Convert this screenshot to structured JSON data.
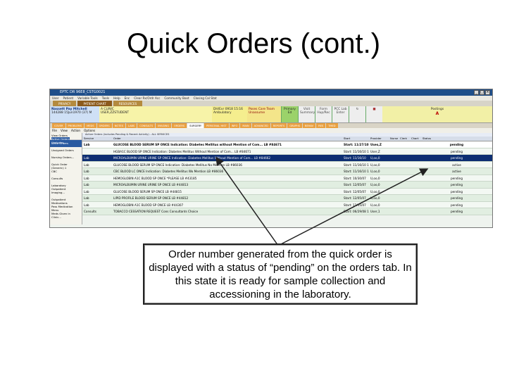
{
  "slide": {
    "title": "Quick Orders (cont.)",
    "callout": "Order number generated from the quick order is displayed with a status of “pending” on the orders tab. In this state it is ready for sample collection and accessioning in the laboratory."
  },
  "app": {
    "window_title": "EPTC DR 96E8_CSTG0021",
    "menu": [
      "User",
      "Patient",
      "Variable Tools",
      "Tools",
      "Help",
      "Enc",
      "Clear Rx/Ordr Acc",
      "Community Boot",
      "Closing Cal Stat"
    ],
    "app_tabs": [
      {
        "label": "PRIVACY",
        "active": false
      },
      {
        "label": "PATIENT CHART",
        "active": true
      },
      {
        "label": "RESOURCES",
        "active": false
      }
    ],
    "patient": {
      "name": "Nassett Pay Mitchell",
      "id": "144288",
      "dob": "15Jun1970 (37)",
      "sex": "M",
      "clinic": "A CLINIC",
      "user": "USER,ZZSTUDENT",
      "dates": "DH/Evr 0918 15:16",
      "visit": "Ambulatory",
      "problem": "Poses Care Team Unassume",
      "btn1a": "Primary",
      "btn1b": "Ed",
      "btn2a": "Visit",
      "btn2b": "Summary",
      "btn3a": "Form",
      "btn3b": "Hup/Rec",
      "btn4a": "PCC Lab",
      "btn4b": "Enter",
      "postings": "Postings",
      "flag": "A"
    },
    "function_tabs": [
      "COVER",
      "PROBLEMS",
      "MEDS",
      "ORDERS",
      "NOTES",
      "LABS",
      "CONSULTS",
      "IMAGING",
      "ORDERS",
      "SURGERY",
      "PERSONAL HIST",
      "INFO",
      "MAIN",
      "ADVANCED",
      "REPORTS",
      "GRAPHS",
      "BEHAV",
      "RES",
      "TMED"
    ],
    "active_function_tab": 9,
    "toolbar": [
      "File",
      "View",
      "Action",
      "Options"
    ],
    "left_nav": {
      "header_a": "View Orders",
      "header_b": "Active Orders (Includes...",
      "items": [
        "Write Orders",
        "Unsigned Orders",
        "Nursing Orders...",
        "Quick Order (Generic) 1",
        "CBC",
        "Consults",
        "Laboratory Outpatient",
        "Imaging...",
        "Outpatient Medications",
        "Pass Medication Menu",
        "Meds Given in Clinic..."
      ]
    },
    "grid": {
      "banner": "Active Orders (includes Pending & Recent Activity) - ALL SERVICES",
      "columns": [
        "Service",
        "Order",
        "Start",
        "Provider",
        "Nurse",
        "Clerk",
        "Chart",
        "Status"
      ],
      "rows": [
        {
          "service": "Lab",
          "order": "GLUCOSE BLOOD SERUM SP ONCE Indication: Diabetes Mellitus without Mention of Com... LB #84671",
          "start": "Start: 11/27/10",
          "provider": "Uses,Z",
          "nurse": "",
          "clerk": "",
          "chart": "",
          "status": "pending",
          "style": "pend"
        },
        {
          "service": "",
          "order": "HGBA1C BLOOD SP ONCE Indication: Diabetes Mellitus Without Mention of Com... LB #84671",
          "start": "Start: 11/16/10 1317",
          "provider": "User,Z",
          "nurse": "",
          "clerk": "",
          "chart": "",
          "status": "pending",
          "style": "alt"
        },
        {
          "service": "Lab",
          "order": "MICROALBUMIN URINE URINE SP ONCE Indication: Diabetes Mellitus Without Mention of Com... LB #84662",
          "start": "Start: 11/16/10",
          "provider": "U,oo,0",
          "nurse": "",
          "clerk": "",
          "chart": "",
          "status": "pending",
          "style": "sel"
        },
        {
          "service": "Lab",
          "order": "GLUCOSE BLOOD SERUM SP ONCE Indication: Diabetes Mellitus No Mention LB #86036",
          "start": "Start: 11/16/10 1500",
          "provider": "U,oo,0",
          "nurse": "",
          "clerk": "",
          "chart": "",
          "status": "active",
          "style": "alt"
        },
        {
          "service": "Lab",
          "order": "CBC BLOOD LC ONCE Indication: Diabetes Mellitus Wo Mention LB #86036",
          "start": "Start: 11/16/10 1500",
          "provider": "U,oo,0",
          "nurse": "",
          "clerk": "",
          "chart": "",
          "status": "active",
          "style": ""
        },
        {
          "service": "Lab",
          "order": "HEMOGLOBIN A1C BLOOD SP ONCE *PLEASE LB #43185",
          "start": "Start: 10/30/07",
          "provider": "U,oo,0",
          "nurse": "",
          "clerk": "",
          "chart": "",
          "status": "pending",
          "style": "alt"
        },
        {
          "service": "Lab",
          "order": "MICROALBUMIN URINE URINE SP ONCE LB #44813",
          "start": "Start: 12/05/07",
          "provider": "U,oo,0",
          "nurse": "",
          "clerk": "",
          "chart": "",
          "status": "pending",
          "style": ""
        },
        {
          "service": "Lab",
          "order": "GLUCOSE BLOOD SERUM SP ONCE LB #44815",
          "start": "Start: 12/05/07",
          "provider": "U,oo,0",
          "nurse": "",
          "clerk": "",
          "chart": "",
          "status": "pending",
          "style": "alt"
        },
        {
          "service": "Lab",
          "order": "LIPID PROFILE BLOOD SERUM SP ONCE LB #44812",
          "start": "Start: 12/05/07",
          "provider": "U,oo,0",
          "nurse": "",
          "clerk": "",
          "chart": "",
          "status": "pending",
          "style": ""
        },
        {
          "service": "Lab",
          "order": "HEMOGLOBIN A1C BLOOD SP ONCE LB #44307",
          "start": "Start: 12/05/07",
          "provider": "U,oo,0",
          "nurse": "",
          "clerk": "",
          "chart": "",
          "status": "pending",
          "style": "alt"
        },
        {
          "service": "Consults",
          "order": "TOBACCO CESSATION REQUEST Cons Consultants Choice",
          "start": "Start: 06/29/08 1323",
          "provider": "User,1",
          "nurse": "",
          "clerk": "",
          "chart": "",
          "status": "pending",
          "style": ""
        }
      ]
    }
  }
}
